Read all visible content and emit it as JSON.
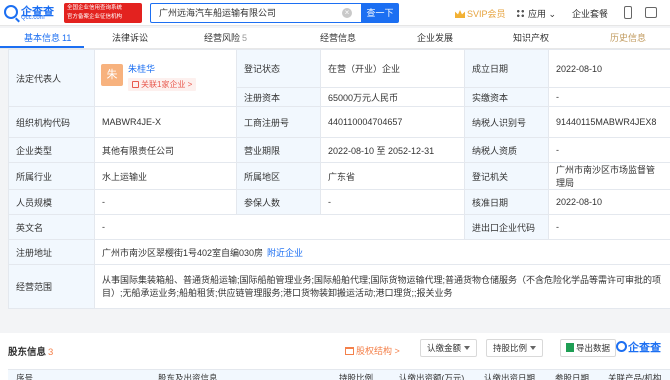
{
  "header": {
    "logo_name": "企查查",
    "logo_domain": "Qcc.com",
    "gov_badge_line1": "全国企业信用查询系统",
    "gov_badge_line2": "官方备案企业征信机构",
    "search_value": "广州远海汽车船运输有限公司",
    "search_button": "查一下",
    "svip": "SVIP会员",
    "apps": "应用",
    "enterprise_kit": "企业套餐"
  },
  "tabs": [
    {
      "label": "基本信息",
      "count": "11"
    },
    {
      "label": "法律诉讼",
      "count": ""
    },
    {
      "label": "经营风险",
      "count": "5"
    },
    {
      "label": "经营信息",
      "count": ""
    },
    {
      "label": "企业发展",
      "count": ""
    },
    {
      "label": "知识产权",
      "count": ""
    },
    {
      "label": "历史信息",
      "count": ""
    }
  ],
  "info": {
    "legal_rep_label": "法定代表人",
    "legal_rep_avatar": "朱",
    "legal_rep_name": "朱桂华",
    "legal_rep_assoc": "关联1家企业 >",
    "reg_status_label": "登记状态",
    "reg_status": "在营（开业）企业",
    "found_date_label": "成立日期",
    "found_date": "2022-08-10",
    "reg_capital_label": "注册资本",
    "reg_capital": "65000万元人民币",
    "paid_capital_label": "实缴资本",
    "paid_capital": "-",
    "org_code_label": "组织机构代码",
    "org_code": "MABWR4JE-X",
    "biz_reg_no_label": "工商注册号",
    "biz_reg_no": "440110004704657",
    "taxpayer_id_label": "纳税人识别号",
    "taxpayer_id": "91440115MABWR4JEX8",
    "company_type_label": "企业类型",
    "company_type": "其他有限责任公司",
    "biz_term_label": "营业期限",
    "biz_term": "2022-08-10 至 2052-12-31",
    "taxpayer_qual_label": "纳税人资质",
    "taxpayer_qual": "-",
    "industry_label": "所属行业",
    "industry": "水上运输业",
    "region_label": "所属地区",
    "region": "广东省",
    "reg_authority_label": "登记机关",
    "reg_authority": "广州市南沙区市场监督管理局",
    "staff_size_label": "人员规模",
    "staff_size": "-",
    "insured_label": "参保人数",
    "insured": "-",
    "approval_date_label": "核准日期",
    "approval_date": "2022-08-10",
    "english_name_label": "英文名",
    "english_name": "-",
    "import_export_label": "进出口企业代码",
    "import_export": "-",
    "address_label": "注册地址",
    "address": "广州市南沙区翠樱街1号402室自编030房",
    "address_link": "附近企业",
    "scope_label": "经营范围",
    "scope": "从事国际集装箱船、普通货船运输;国际船舶管理业务;国际船舶代理;国际货物运输代理;普通货物仓储服务（不含危险化学品等需许可审批的项目）;无船承运业务;船舶租赁;供应链管理服务;港口货物装卸搬运活动;港口理货;;报关业务"
  },
  "shareholders": {
    "title": "股东信息",
    "count": "3",
    "equity_link": "股权结构 >",
    "filter_amount": "认缴金额",
    "filter_ratio": "持股比例",
    "export": "导出数据",
    "columns": [
      "序号",
      "股东及出资信息",
      "持股比例",
      "认缴出资额(万元)",
      "认缴出资日期",
      "参股日期",
      "关联产品/机构"
    ]
  },
  "colors": {
    "brand": "#1c6ff2",
    "label_bg": "#f2f8fe",
    "accent_orange": "#f4804a",
    "badge_red": "#e3221f"
  }
}
